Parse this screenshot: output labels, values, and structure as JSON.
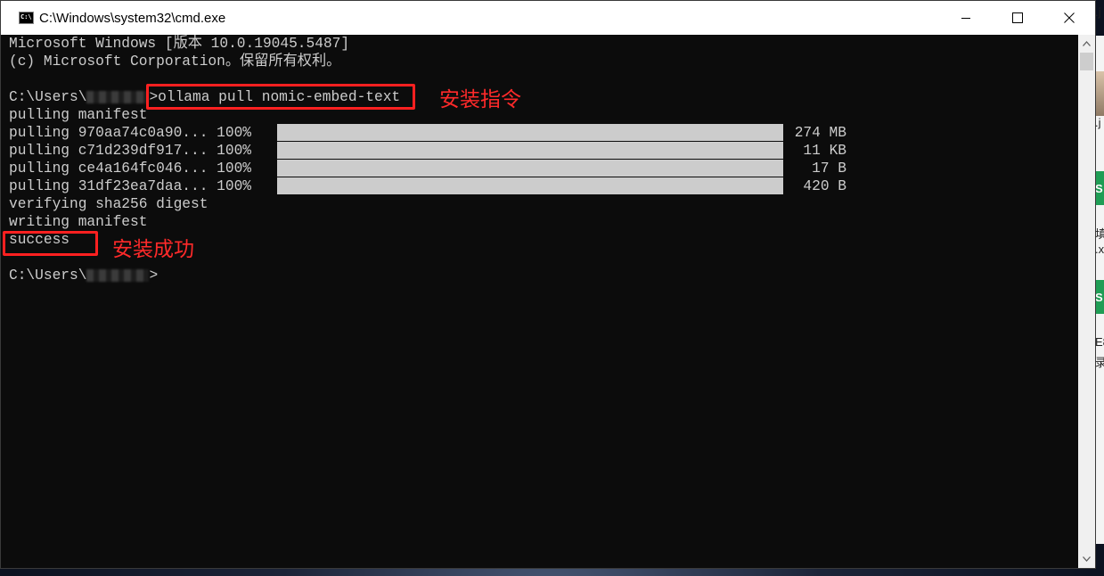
{
  "window": {
    "title": "C:\\Windows\\system32\\cmd.exe",
    "icon_text": "C:\\",
    "buttons": [
      "minimize",
      "maximize",
      "close"
    ]
  },
  "console": {
    "lines": [
      "Microsoft Windows [版本 10.0.19045.5487]",
      "(c) Microsoft Corporation。保留所有权利。",
      "",
      "",
      "pulling manifest",
      "",
      "",
      "",
      "",
      "verifying sha256 digest",
      "writing manifest",
      "success",
      "",
      ""
    ],
    "prompt_prefix": "C:\\Users\\",
    "prompt_suffix": ">",
    "command": "ollama pull nomic-embed-text",
    "layers": [
      {
        "label": "pulling 970aa74c0a90... 100%",
        "progress": 1.0,
        "size": "274 MB"
      },
      {
        "label": "pulling c71d239df917... 100%",
        "progress": 1.0,
        "size": "11 KB"
      },
      {
        "label": "pulling ce4a164fc046... 100%",
        "progress": 1.0,
        "size": "17 B"
      },
      {
        "label": "pulling 31df23ea7daa... 100%",
        "progress": 1.0,
        "size": "420 B"
      }
    ]
  },
  "annotations": {
    "command_note": "安装指令",
    "success_note": "安装成功",
    "color": "#ff2020"
  },
  "desktop": {
    "fragments": [
      ".j",
      ".j",
      "填",
      ".x",
      "E8",
      "录"
    ],
    "icon_letter": "S"
  }
}
